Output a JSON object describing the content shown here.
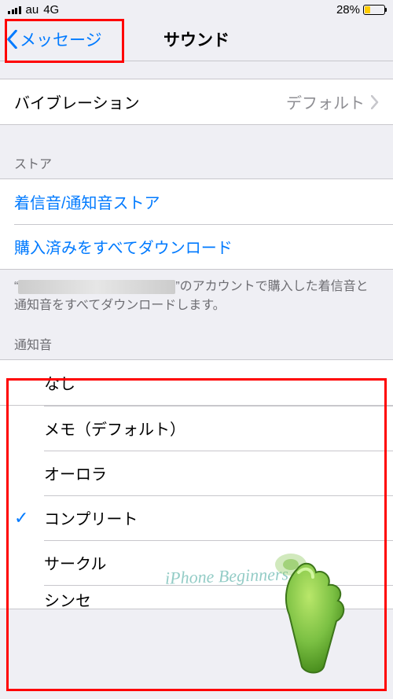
{
  "status": {
    "carrier": "au",
    "network": "4G",
    "battery_pct": "28%"
  },
  "nav": {
    "back_label": "メッセージ",
    "title": "サウンド"
  },
  "vibration": {
    "label": "バイブレーション",
    "value": "デフォルト"
  },
  "store": {
    "header": "ストア",
    "tone_store": "着信音/通知音ストア",
    "download_all": "購入済みをすべてダウンロード",
    "footer_prefix": "“",
    "footer_suffix": "”のアカウントで購入した着信音と通知音をすべてダウンロードします。"
  },
  "alert_tones": {
    "header": "通知音",
    "items": [
      "なし",
      "メモ（デフォルト）",
      "オーロラ",
      "コンプリート",
      "サークル",
      "シンセ"
    ],
    "selected_index": 3
  },
  "watermark": "iPhone Beginners"
}
